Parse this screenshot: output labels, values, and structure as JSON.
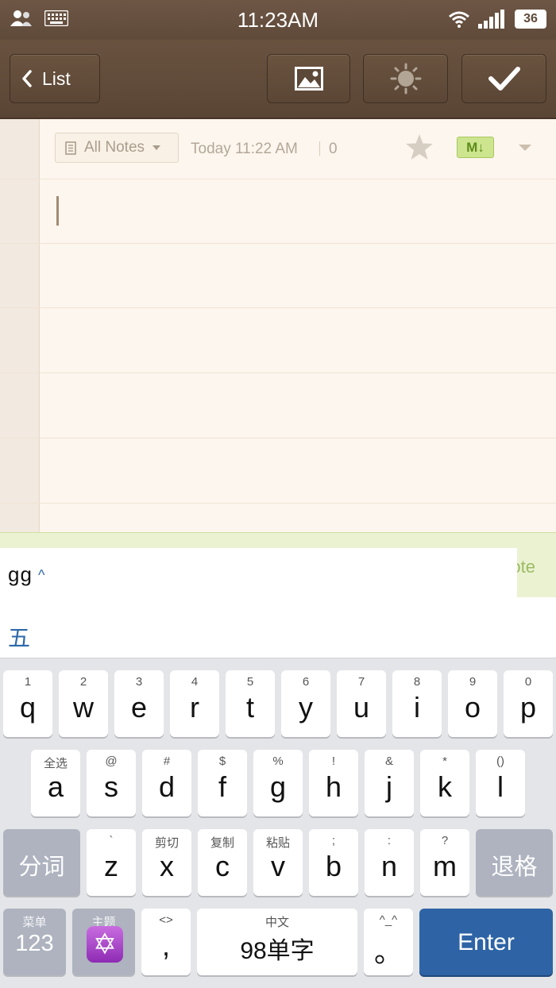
{
  "status_bar": {
    "time": "11:23AM",
    "battery": "36"
  },
  "header": {
    "back_label": "List"
  },
  "note": {
    "notebook": "All Notes",
    "date": "Today 11:22 AM",
    "word_count": "0",
    "format_badge": "M↓",
    "body": ""
  },
  "strip": {
    "hint": "ote"
  },
  "ime": {
    "composition": "gg",
    "candidates": [
      "五"
    ]
  },
  "keyboard": {
    "row1": [
      {
        "key": "q",
        "sub": "1"
      },
      {
        "key": "w",
        "sub": "2"
      },
      {
        "key": "e",
        "sub": "3"
      },
      {
        "key": "r",
        "sub": "4"
      },
      {
        "key": "t",
        "sub": "5"
      },
      {
        "key": "y",
        "sub": "6"
      },
      {
        "key": "u",
        "sub": "7"
      },
      {
        "key": "i",
        "sub": "8"
      },
      {
        "key": "o",
        "sub": "9"
      },
      {
        "key": "p",
        "sub": "0"
      }
    ],
    "row2": [
      {
        "key": "a",
        "sub": "全选"
      },
      {
        "key": "s",
        "sub": "@"
      },
      {
        "key": "d",
        "sub": "#"
      },
      {
        "key": "f",
        "sub": "$"
      },
      {
        "key": "g",
        "sub": "%"
      },
      {
        "key": "h",
        "sub": "!"
      },
      {
        "key": "j",
        "sub": "&"
      },
      {
        "key": "k",
        "sub": "*"
      },
      {
        "key": "l",
        "sub": "()"
      }
    ],
    "row3": [
      {
        "key": "z",
        "sub": "`"
      },
      {
        "key": "x",
        "sub": "剪切"
      },
      {
        "key": "c",
        "sub": "复制"
      },
      {
        "key": "v",
        "sub": "粘贴"
      },
      {
        "key": "b",
        "sub": ";"
      },
      {
        "key": "n",
        "sub": ":"
      },
      {
        "key": "m",
        "sub": "?"
      }
    ],
    "segment": "分词",
    "backspace": "退格",
    "num_key": {
      "key": "123",
      "sub": "菜单"
    },
    "theme_key": {
      "sub": "主题"
    },
    "comma_key": {
      "key": ",",
      "sub": "<>"
    },
    "space_key": {
      "key": "98单字",
      "sub": "中文"
    },
    "period_key": {
      "key": "。",
      "sub": "^_^"
    },
    "enter": "Enter"
  }
}
